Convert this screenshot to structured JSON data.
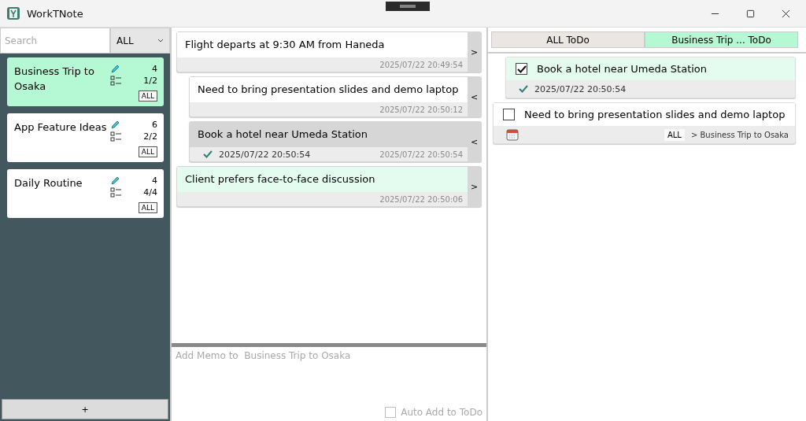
{
  "window": {
    "title": "WorkTNote"
  },
  "sidebar": {
    "search": {
      "placeholder": "Search"
    },
    "filter": {
      "value": "ALL"
    },
    "categories": [
      {
        "name": "Business Trip to Osaka",
        "memo_count": "4",
        "todo_count": "1/2",
        "button": "ALL",
        "selected": true
      },
      {
        "name": "App Feature Ideas",
        "memo_count": "6",
        "todo_count": "2/2",
        "button": "ALL",
        "selected": false
      },
      {
        "name": "Daily Routine",
        "memo_count": "4",
        "todo_count": "4/4",
        "button": "ALL",
        "selected": false
      }
    ],
    "add_button": "+"
  },
  "memos": [
    {
      "text": "Flight departs at 9:30 AM from Haneda",
      "time": "2025/07/22 20:49:54",
      "arrow": ">",
      "indented": false,
      "highlighted": false,
      "completed": false
    },
    {
      "text": "Need to bring presentation slides and demo laptop",
      "time": "2025/07/22 20:50:12",
      "arrow": "<",
      "indented": true,
      "highlighted": false,
      "completed": false
    },
    {
      "text": "Book a hotel near Umeda Station",
      "time": "2025/07/22 20:50:54",
      "arrow": "<",
      "indented": true,
      "highlighted": false,
      "completed": true,
      "completed_time": "2025/07/22 20:50:54"
    },
    {
      "text": "Client prefers face-to-face discussion",
      "time": "2025/07/22 20:50:06",
      "arrow": ">",
      "indented": false,
      "highlighted": true,
      "completed": false
    }
  ],
  "memo_input": {
    "placeholder": "Add Memo to  Business Trip to Osaka",
    "auto_add": {
      "label": "Auto Add to ToDo",
      "checked": false
    }
  },
  "todo_tabs": [
    {
      "label": "ALL ToDo",
      "selected": false
    },
    {
      "label": "Business Trip ... ToDo",
      "selected": true
    }
  ],
  "todos": [
    {
      "text": "Book a hotel near Umeda Station",
      "checked": true,
      "indented": true,
      "done_time": "2025/07/22 20:50:54"
    },
    {
      "text": "Need to bring presentation slides and demo laptop",
      "checked": false,
      "indented": false,
      "tag": "ALL",
      "path": "> Business Trip to Osaka"
    }
  ]
}
